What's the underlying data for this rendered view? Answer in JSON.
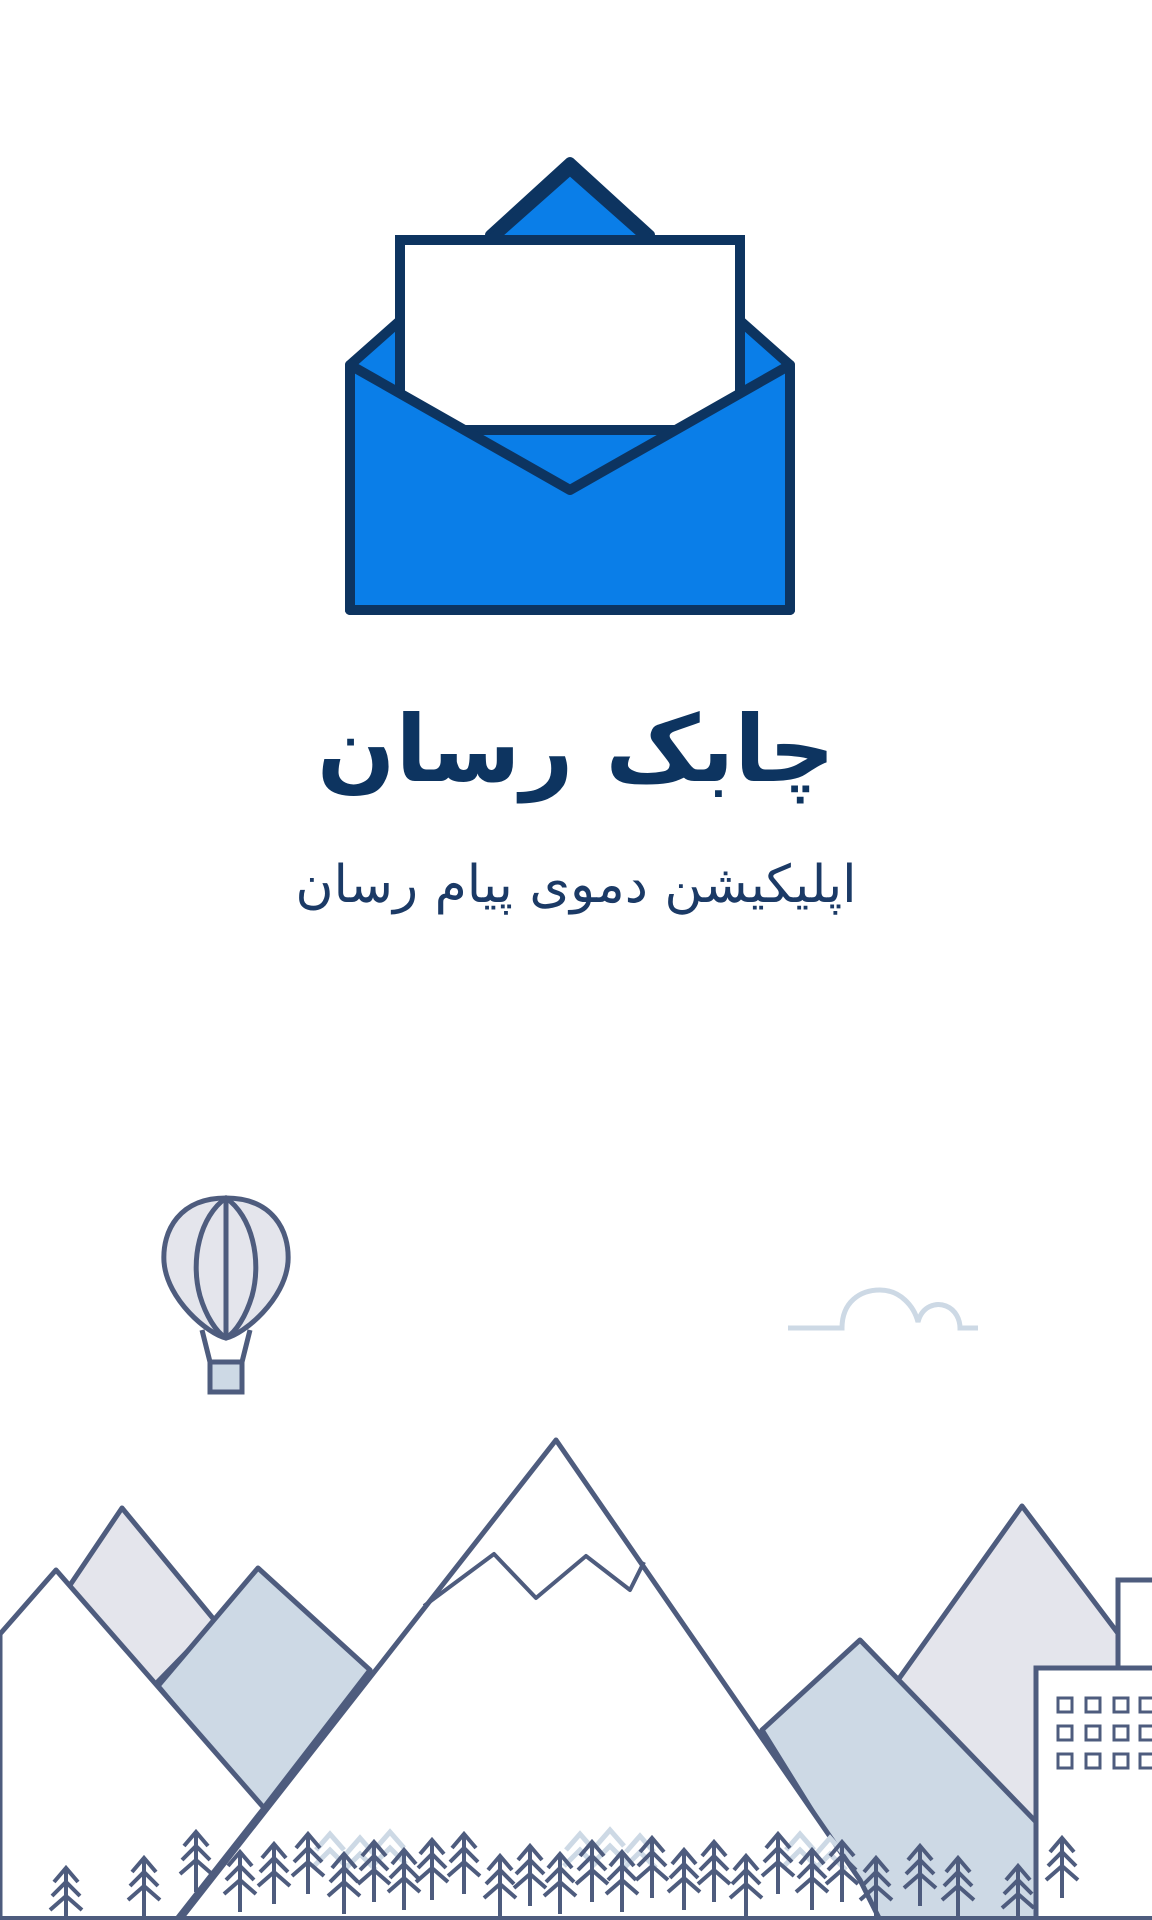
{
  "app": {
    "title": "چابک رسان",
    "subtitle": "اپلیکیشن دموی پیام رسان"
  },
  "icons": {
    "logo": "open-envelope-icon",
    "balloon": "hot-air-balloon-icon",
    "cloud": "cloud-icon"
  },
  "colors": {
    "primary": "#0a7ee8",
    "primary_dark": "#0d3460",
    "outline": "#4e5c7e",
    "mountain_fill": "#cdd9e5",
    "mountain_light": "#e4e5ec",
    "background": "#ffffff"
  }
}
